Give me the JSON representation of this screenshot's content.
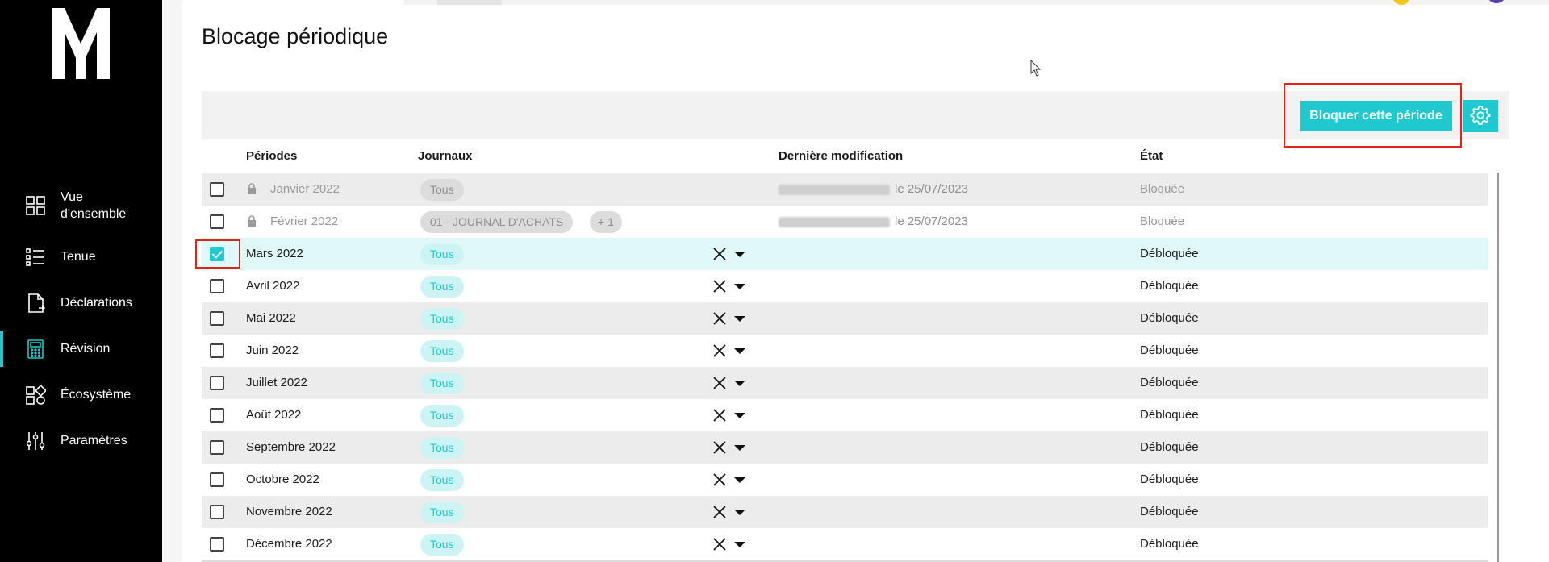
{
  "sidebar": {
    "items": [
      {
        "label": "Vue d'ensemble",
        "icon": "grid-icon"
      },
      {
        "label": "Tenue",
        "icon": "list-icon"
      },
      {
        "label": "Déclarations",
        "icon": "document-icon"
      },
      {
        "label": "Révision",
        "icon": "calculator-icon",
        "active": true
      },
      {
        "label": "Écosystème",
        "icon": "ecosystem-icon"
      },
      {
        "label": "Paramètres",
        "icon": "sliders-icon"
      }
    ]
  },
  "page": {
    "title": "Blocage périodique"
  },
  "toolbar": {
    "block_label": "Bloquer cette période",
    "settings_icon": "gear-icon"
  },
  "table": {
    "headers": [
      "Périodes",
      "Journaux",
      "Dernière modification",
      "État"
    ],
    "rows": [
      {
        "period": "Janvier 2022",
        "journal": "Tous",
        "modified": "le 25/07/2023",
        "state": "Bloquée",
        "locked": true,
        "checked": false
      },
      {
        "period": "Février 2022",
        "journal": "01 - JOURNAL D'ACHATS",
        "journal_extra": "+ 1",
        "modified": "le 25/07/2023",
        "state": "Bloquée",
        "locked": true,
        "checked": false
      },
      {
        "period": "Mars 2022",
        "journal": "Tous",
        "modified": "",
        "state": "Débloquée",
        "locked": false,
        "checked": true
      },
      {
        "period": "Avril 2022",
        "journal": "Tous",
        "modified": "",
        "state": "Débloquée",
        "locked": false,
        "checked": false
      },
      {
        "period": "Mai 2022",
        "journal": "Tous",
        "modified": "",
        "state": "Débloquée",
        "locked": false,
        "checked": false
      },
      {
        "period": "Juin 2022",
        "journal": "Tous",
        "modified": "",
        "state": "Débloquée",
        "locked": false,
        "checked": false
      },
      {
        "period": "Juillet 2022",
        "journal": "Tous",
        "modified": "",
        "state": "Débloquée",
        "locked": false,
        "checked": false
      },
      {
        "period": "Août 2022",
        "journal": "Tous",
        "modified": "",
        "state": "Débloquée",
        "locked": false,
        "checked": false
      },
      {
        "period": "Septembre 2022",
        "journal": "Tous",
        "modified": "",
        "state": "Débloquée",
        "locked": false,
        "checked": false
      },
      {
        "period": "Octobre 2022",
        "journal": "Tous",
        "modified": "",
        "state": "Débloquée",
        "locked": false,
        "checked": false
      },
      {
        "period": "Novembre 2022",
        "journal": "Tous",
        "modified": "",
        "state": "Débloquée",
        "locked": false,
        "checked": false
      },
      {
        "period": "Décembre 2022",
        "journal": "Tous",
        "modified": "",
        "state": "Débloquée",
        "locked": false,
        "checked": false
      }
    ]
  },
  "colors": {
    "accent": "#1ec9d0",
    "sidebar_bg": "#000000",
    "highlight": "#e0231b"
  }
}
